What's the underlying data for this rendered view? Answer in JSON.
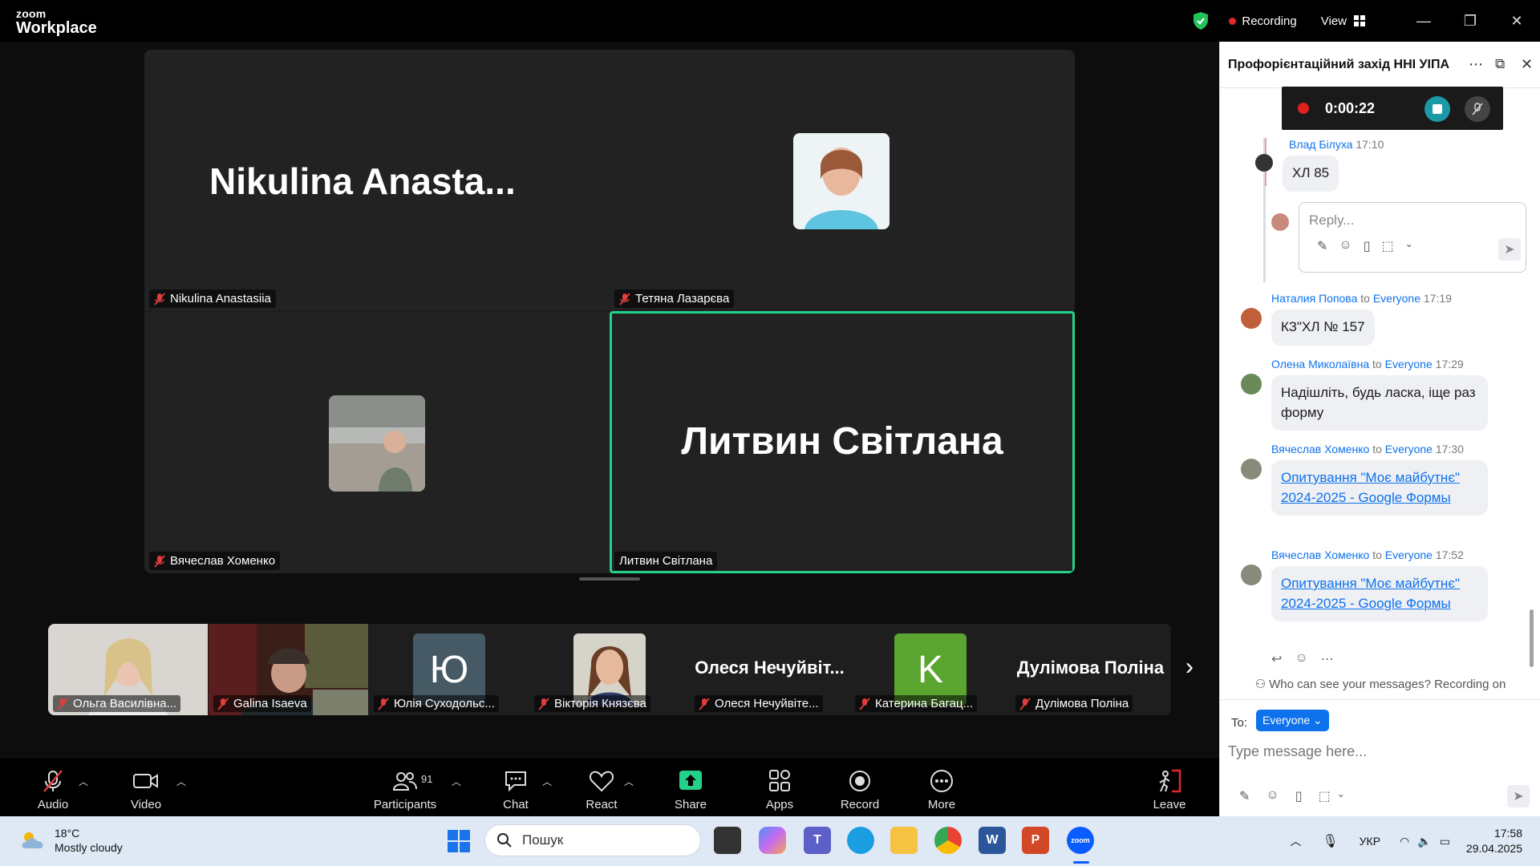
{
  "app": {
    "brand_small": "zoom",
    "brand_large": "Workplace",
    "recording_label": "Recording",
    "view_label": "View",
    "minimize": "—",
    "maximize": "❐",
    "close": "✕"
  },
  "gallery": {
    "tiles": [
      {
        "big_name": "Nikulina  Anasta...",
        "label": "Nikulina Anastasiia"
      },
      {
        "big_name": "",
        "label": "Тетяна Лазарєва"
      },
      {
        "big_name": "",
        "label": "Вячеслав Хоменко"
      },
      {
        "big_name": "Литвин Світлана",
        "label": "Литвин Світлана"
      }
    ]
  },
  "strip": {
    "tiles": [
      {
        "label": "Ольга Василівна...",
        "letter": "",
        "big": ""
      },
      {
        "label": "Galina Isaeva",
        "letter": "",
        "big": ""
      },
      {
        "label": "Юлія Суходольс...",
        "letter": "Ю",
        "big": ""
      },
      {
        "label": "Вікторія Князєва",
        "letter": "",
        "big": ""
      },
      {
        "label": "Олеся Нечуйвіте...",
        "letter": "",
        "big": "Олеся  Нечуйвіт..."
      },
      {
        "label": "Катерина Багац...",
        "letter": "K",
        "big": ""
      },
      {
        "label": "Дулімова Поліна",
        "letter": "",
        "big": "Дулімова Поліна"
      }
    ],
    "next": "›"
  },
  "toolbar": {
    "audio": "Audio",
    "video": "Video",
    "participants": "Participants",
    "participants_count": "91",
    "chat": "Chat",
    "react": "React",
    "share": "Share",
    "apps": "Apps",
    "record": "Record",
    "more": "More",
    "leave": "Leave"
  },
  "chat": {
    "title": "Профорієнтаційний захід ННІ УІПА",
    "recording_time": "0:00:22",
    "thread_reply": {
      "sender": "Влад Білуха",
      "time": "17:10",
      "text": "ХЛ 85"
    },
    "reply_placeholder": "Reply...",
    "messages": [
      {
        "sender": "Наталия Попова",
        "to": "to",
        "target": "Everyone",
        "time": "17:19",
        "text": "КЗ\"ХЛ № 157"
      },
      {
        "sender": "Олена Миколаївна",
        "to": "to",
        "target": "Everyone",
        "time": "17:29",
        "text": "Надішліть, будь ласка, іще раз форму"
      },
      {
        "sender": "Вячеслав Хоменко",
        "to": "to",
        "target": "Everyone",
        "time": "17:30",
        "text": "Опитування \"Моє майбутнє\" 2024-2025 - Google Формы"
      },
      {
        "sender": "Вячеслав Хоменко",
        "to": "to",
        "target": "Everyone",
        "time": "17:52",
        "text": "Опитування \"Моє майбутнє\" 2024-2025 - Google Формы"
      }
    ],
    "visibility_note": "Who can see your messages? Recording on",
    "to_label": "To:",
    "to_value": "Everyone",
    "compose_placeholder": "Type message here..."
  },
  "taskbar": {
    "temperature": "18°C",
    "weather": "Mostly cloudy",
    "search_placeholder": "Пошук",
    "language": "УКР",
    "time": "17:58",
    "date": "29.04.2025"
  },
  "colors": {
    "accent": "#0e72ed",
    "active_speaker": "#23d18b",
    "share_green": "#23d18b",
    "record_red": "#e02828",
    "leave_red": "#e02828"
  }
}
